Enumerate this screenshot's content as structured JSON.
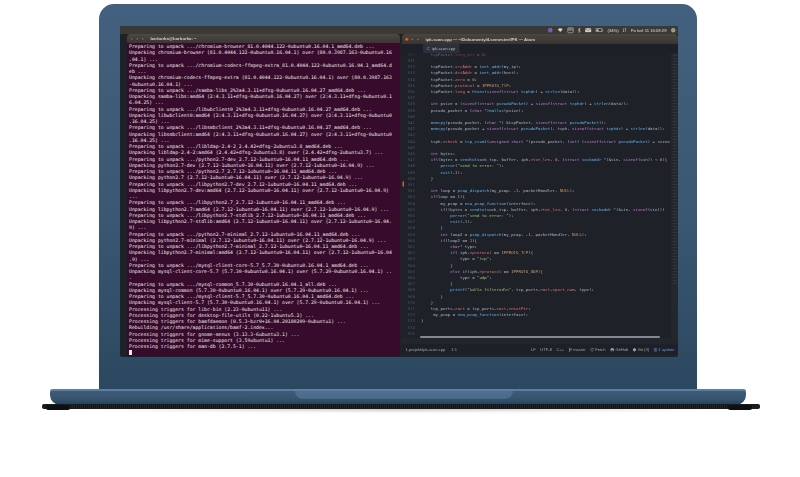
{
  "panel": {
    "keyboard_indicator": "EN",
    "battery_label": "(34%)",
    "clock": "Po kvě 11 16:09:29"
  },
  "terminal": {
    "title": "barborka@barborka: ~",
    "lines": [
      "Preparing to unpack .../chromium-browser_81.0.4044.122-0ubuntu0.16.04.1_amd64.deb ...",
      "Unpacking chromium-browser (81.0.4044.122-0ubuntu0.16.04.1) over (80.0.3987.163-0ubuntu0.16",
      ".04.1) ...",
      "Preparing to unpack .../chromium-codecs-ffmpeg-extra_81.0.4044.122-0ubuntu0.16.04.1_amd64.d",
      "eb ...",
      "Unpacking chromium-codecs-ffmpeg-extra (81.0.4044.122-0ubuntu0.16.04.1) over (80.0.3987.163",
      "-0ubuntu0.16.04.1) ...",
      "Preparing to unpack .../samba-libs_2%3a4.3.11+dfsg-0ubuntu0.16.04.27_amd64.deb ...",
      "Unpacking samba-libs:amd64 (2:4.3.11+dfsg-0ubuntu0.16.04.27) over (2:4.3.11+dfsg-0ubuntu0.1",
      "6.04.25) ...",
      "Preparing to unpack .../libwbclient0_2%3a4.3.11+dfsg-0ubuntu0.16.04.27_amd64.deb ...",
      "Unpacking libwbclient0:amd64 (2:4.3.11+dfsg-0ubuntu0.16.04.27) over (2:4.3.11+dfsg-0ubuntu0",
      ".16.04.25) ...",
      "Preparing to unpack .../libsmbclient_2%3a4.3.11+dfsg-0ubuntu0.16.04.27_amd64.deb ...",
      "Unpacking libsmbclient:amd64 (2:4.3.11+dfsg-0ubuntu0.16.04.27) over (2:4.3.11+dfsg-0ubuntu0",
      ".16.04.25) ...",
      "Preparing to unpack .../libldap-2.4-2_2.4.42+dfsg-2ubuntu3.8_amd64.deb ...",
      "Unpacking libldap-2.4-2:amd64 (2.4.42+dfsg-2ubuntu3.8) over (2.4.42+dfsg-2ubuntu3.7) ...",
      "Preparing to unpack .../python2.7-dev_2.7.12-1ubuntu0~16.04.11_amd64.deb ...",
      "Unpacking python2.7-dev (2.7.12-1ubuntu0~16.04.11) over (2.7.12-1ubuntu0~16.04.9) ...",
      "Preparing to unpack .../python2.7_2.7.12-1ubuntu0~16.04.11_amd64.deb ...",
      "Unpacking python2.7 (2.7.12-1ubuntu0~16.04.11) over (2.7.12-1ubuntu0~16.04.9) ...",
      "Preparing to unpack .../libpython2.7-dev_2.7.12-1ubuntu0~16.04.11_amd64.deb ...",
      "Unpacking libpython2.7-dev:amd64 (2.7.12-1ubuntu0~16.04.11) over (2.7.12-1ubuntu0~16.04.9)",
      "...",
      "Preparing to unpack .../libpython2.7_2.7.12-1ubuntu0~16.04.11_amd64.deb ...",
      "Unpacking libpython2.7:amd64 (2.7.12-1ubuntu0~16.04.11) over (2.7.12-1ubuntu0~16.04.9) ...",
      "Preparing to unpack .../libpython2.7-stdlib_2.7.12-1ubuntu0~16.04.11_amd64.deb ...",
      "Unpacking libpython2.7-stdlib:amd64 (2.7.12-1ubuntu0~16.04.11) over (2.7.12-1ubuntu0~16.04.",
      "9) ...",
      "Preparing to unpack .../python2.7-minimal_2.7.12-1ubuntu0~16.04.11_amd64.deb ...",
      "Unpacking python2.7-minimal (2.7.12-1ubuntu0~16.04.11) over (2.7.12-1ubuntu0~16.04.9) ...",
      "Preparing to unpack .../libpython2.7-minimal_2.7.12-1ubuntu0~16.04.11_amd64.deb ...",
      "Unpacking libpython2.7-minimal:amd64 (2.7.12-1ubuntu0~16.04.11) over (2.7.12-1ubuntu0~16.04",
      ".9) ...",
      "Preparing to unpack .../mysql-client-core-5.7_5.7.30-0ubuntu0.16.04.1_amd64.deb ...",
      "Unpacking mysql-client-core-5.7 (5.7.30-0ubuntu0.16.04.1) over (5.7.29-0ubuntu0.16.04.1) ..",
      ".",
      "Preparing to unpack .../mysql-common_5.7.30-0ubuntu0.16.04.1_all.deb ...",
      "Unpacking mysql-common (5.7.30-0ubuntu0.16.04.1) over (5.7.29-0ubuntu0.16.04.1) ...",
      "Preparing to unpack .../mysql-client-5.7_5.7.30-0ubuntu0.16.04.1_amd64.deb ...",
      "Unpacking mysql-client-5.7 (5.7.30-0ubuntu0.16.04.1) over (5.7.29-0ubuntu0.16.04.1) ...",
      "Processing triggers for libc-bin (2.23-0ubuntu11) ...",
      "Processing triggers for desktop-file-utils (0.22-1ubuntu5.2) ...",
      "Processing triggers for bamfdaemon (0.5.3~bzr0+16.04.20180209-0ubuntu1) ...",
      "Rebuilding /usr/share/applications/bamf-2.index...",
      "Processing triggers for gnome-menus (3.13.3-6ubuntu3.1) ...",
      "Processing triggers for mime-support (3.59ubuntu1) ...",
      "Processing triggers for man-db (2.7.5-1) ..."
    ]
  },
  "atom": {
    "title": "ipk-scan.cpp — ~/Dokumenty/4.semester/IPK — Atom",
    "tab": "ipk-scan.cpp",
    "tab_icon": "C",
    "code": [
      {
        "n": 530,
        "t": "    tcpPacket.leng_ptr = 0;",
        "dim": true
      },
      {
        "n": 531,
        "t": ""
      },
      {
        "n": 532,
        "t": "    tcpPacket.srcAddr = inet_addr(my_ip);"
      },
      {
        "n": 533,
        "t": "    tcpPacket.dstAddr = inet_addr(host);"
      },
      {
        "n": 534,
        "t": "    tcpPacket.zero = 0;"
      },
      {
        "n": 535,
        "t": "    tcpPacket.protocol = IPPROTO_TCP;"
      },
      {
        "n": 536,
        "t": "    tcpPacket.leng = htons(sizeof(struct tcphdr) + strlen(data));"
      },
      {
        "n": 537,
        "t": ""
      },
      {
        "n": 538,
        "t": "    int psize = (sizeof(struct pseudoPacket) + sizeof(struct tcphdr) + strlen(data));"
      },
      {
        "n": 539,
        "t": "    pseudo_packet = (char *)malloc(psize);"
      },
      {
        "n": 540,
        "t": ""
      },
      {
        "n": 541,
        "t": "    memcpy(pseudo_packet, (char *) &tcpPacket, sizeof(struct pseudoPacket));"
      },
      {
        "n": 542,
        "t": "    memcpy(pseudo_packet + sizeof(struct pseudoPacket), tcph, sizeof(struct tcphdr) + strlen(data));"
      },
      {
        "n": 543,
        "t": ""
      },
      {
        "n": 544,
        "t": "    tcph->check = tcp_csum((unsigned short *)pseudo_packet, (int) (sizeof(struct pseudoPacket) + sizeo"
      },
      {
        "n": 545,
        "t": ""
      },
      {
        "n": 546,
        "t": "    int bytes;"
      },
      {
        "n": 547,
        "t": "    if((bytes = sendto(sock_tcp, buffer, iph->tot_len, 0, (struct sockaddr *)&sin, sizeof(sin)) < 0){"
      },
      {
        "n": 548,
        "t": "        perror(\"send to error: \");"
      },
      {
        "n": 549,
        "t": "        exit(-1);"
      },
      {
        "n": 550,
        "t": "    }"
      },
      {
        "n": 551,
        "t": "",
        "mark": true
      },
      {
        "n": 552,
        "t": "    int loop = pcap_dispatch(my_pcap, -1, packetHandler, NULL);"
      },
      {
        "n": 553,
        "t": "    if(loop == 1){"
      },
      {
        "n": 554,
        "t": "        my_pcap = new_pcap_function(interface);"
      },
      {
        "n": 555,
        "t": "        if((bytes = sendto(sock_tcp, buffer, iph->tot_len, 0, (struct sockaddr *)&sin, sizeof(sin)))"
      },
      {
        "n": 556,
        "t": "            perror(\"send to error: \");"
      },
      {
        "n": 557,
        "t": "            exit(-1);"
      },
      {
        "n": 558,
        "t": "        }"
      },
      {
        "n": 559,
        "t": "        int loop2 = pcap_dispatch(my_pcap, -1, packetHandler, NULL);"
      },
      {
        "n": 560,
        "t": "        if(loop2 == 1){"
      },
      {
        "n": 561,
        "t": "            char* type;"
      },
      {
        "n": 562,
        "t": "            if( iph->protocol == IPPROTO_TCP){"
      },
      {
        "n": 563,
        "t": "                type = \"tcp\";"
      },
      {
        "n": 564,
        "t": "            }"
      },
      {
        "n": 565,
        "t": "            else if(iph->protocol == IPPROTO_UDP){"
      },
      {
        "n": 566,
        "t": "                type = \"udp\";"
      },
      {
        "n": 567,
        "t": "            }"
      },
      {
        "n": 568,
        "t": "            printf(\"%d/%s filtered\\n\", tcp_ports->act->port_num, type);"
      },
      {
        "n": 569,
        "t": "        }"
      },
      {
        "n": 570,
        "t": "    }"
      },
      {
        "n": 571,
        "t": "    tcp_ports->act = tcp_ports->act->nextPtr;"
      },
      {
        "n": 572,
        "t": "     my_pcap = new_pcap_function(interface);"
      },
      {
        "n": 573,
        "t": "}"
      },
      {
        "n": 574,
        "t": ""
      },
      {
        "n": 575,
        "t": ""
      }
    ],
    "status": {
      "left": "1.projekt/ipk-scan.cpp",
      "cursor": "1:1",
      "items": [
        {
          "label": "LF",
          "icon": "none"
        },
        {
          "label": "UTF-8",
          "icon": "none"
        },
        {
          "label": "C++",
          "icon": "none"
        },
        {
          "label": "master",
          "icon": "branch"
        },
        {
          "label": "Fetch",
          "icon": "sync"
        },
        {
          "label": "GitHub",
          "icon": "github"
        },
        {
          "label": "Git (3)",
          "icon": "git"
        }
      ],
      "update": "1 update"
    }
  }
}
